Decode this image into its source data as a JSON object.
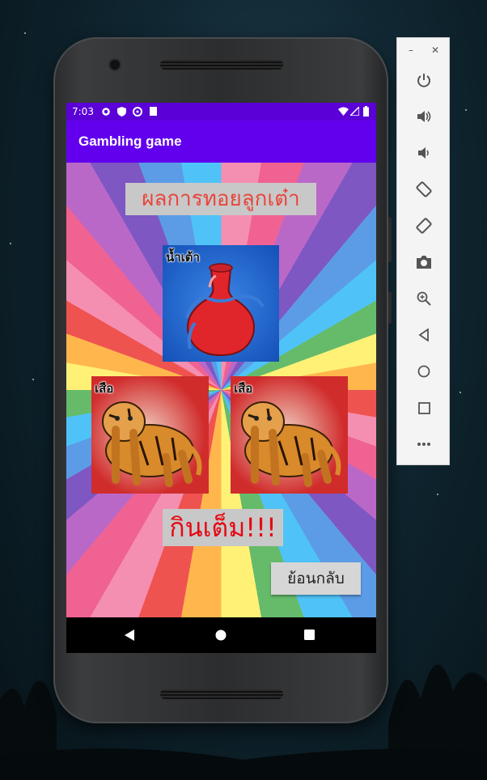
{
  "status": {
    "time": "7:03"
  },
  "app": {
    "title": "Gambling game"
  },
  "screen": {
    "result_title": "ผลการทอยลูกเต๋า",
    "dice": [
      {
        "label": "น้ำเต้า",
        "image": "gourd"
      },
      {
        "label": "เสือ",
        "image": "tiger"
      },
      {
        "label": "เสือ",
        "image": "tiger"
      }
    ],
    "outcome": "กินเต็ม!!!",
    "back_label": "ย้อนกลับ"
  },
  "emulator_toolbar": {
    "controls": [
      "minimize-icon",
      "close-icon",
      "power-icon",
      "volume-up-icon",
      "volume-down-icon",
      "rotate-left-icon",
      "rotate-right-icon",
      "camera-icon",
      "zoom-icon",
      "back-icon",
      "home-icon",
      "overview-icon",
      "more-icon"
    ]
  },
  "colors": {
    "appbar": "#6200ee",
    "statusbar": "#5b00d6",
    "title_text": "#e8453c",
    "outcome_text": "#e50914"
  }
}
